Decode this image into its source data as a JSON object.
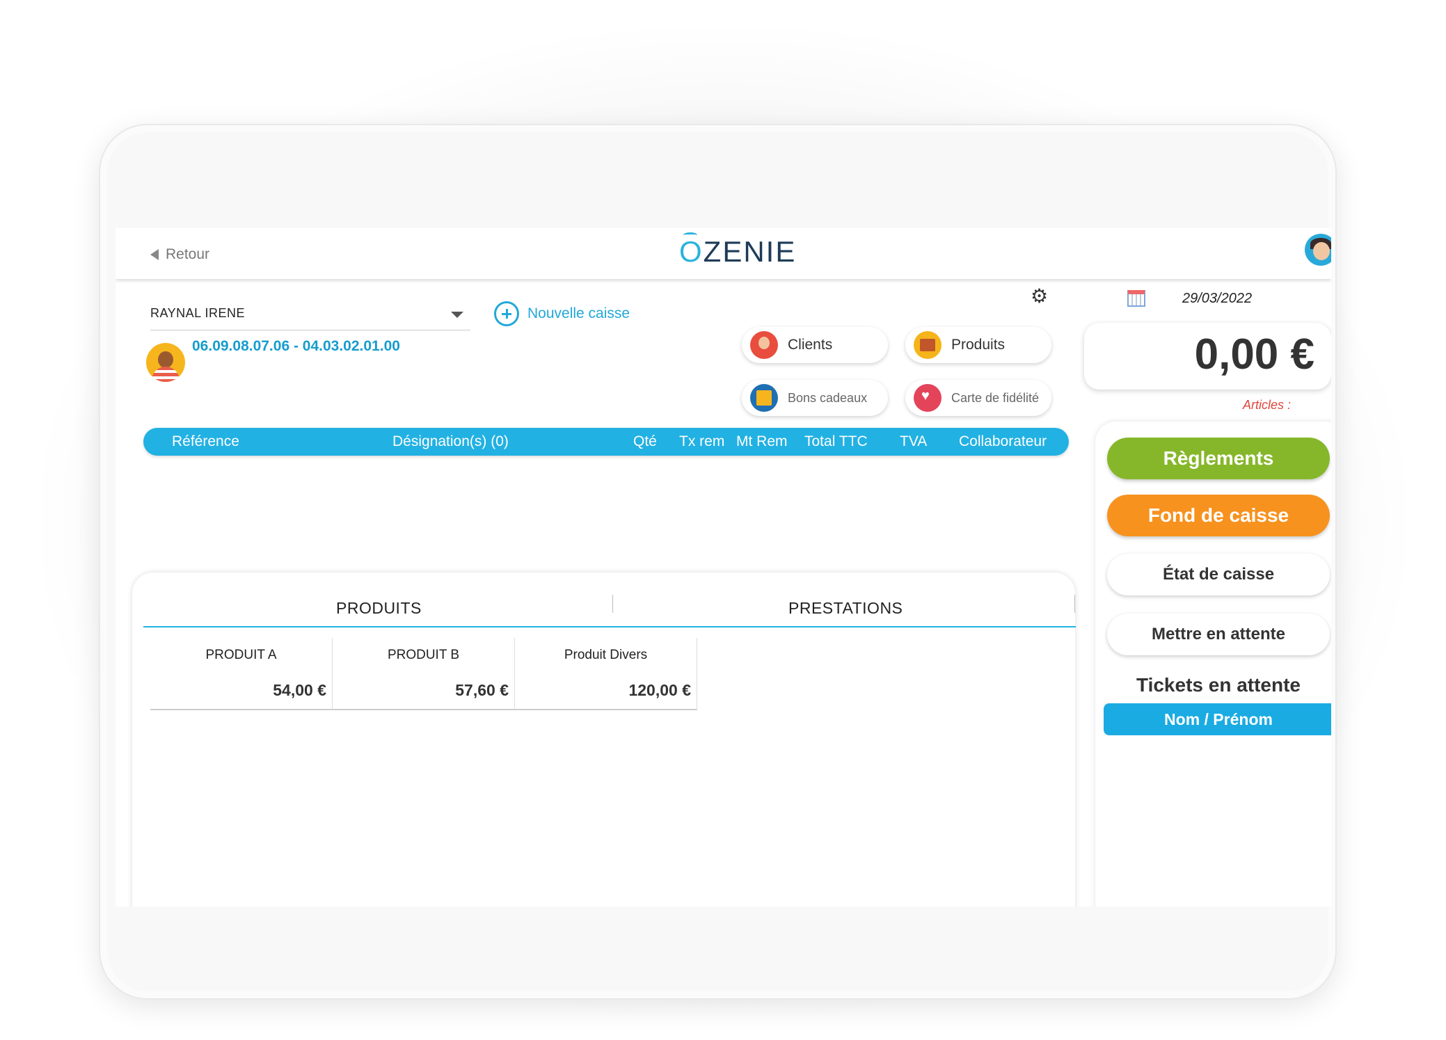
{
  "topbar": {
    "back_label": "Retour",
    "logo_text": "ZENIE",
    "logo_o": "O"
  },
  "client": {
    "name": "RAYNAL IRENE",
    "phone": "06.09.08.07.06 - 04.03.02.01.00"
  },
  "actions": {
    "nouvelle_caisse": "Nouvelle caisse",
    "clients": "Clients",
    "produits": "Produits",
    "bons_cadeaux": "Bons cadeaux",
    "carte_fidelite": "Carte de fidélité"
  },
  "table": {
    "columns": [
      "Référence",
      "Désignation(s) (0)",
      "Qté",
      "Tx rem",
      "Mt Rem",
      "Total TTC",
      "TVA",
      "Collaborateur"
    ]
  },
  "catalog": {
    "tabs": [
      "PRODUITS",
      "PRESTATIONS"
    ],
    "products": [
      {
        "name": "PRODUIT A",
        "price": "54,00 €"
      },
      {
        "name": "PRODUIT B",
        "price": "57,60 €"
      },
      {
        "name": "Produit Divers",
        "price": "120,00 €"
      }
    ]
  },
  "summary": {
    "date": "29/03/2022",
    "total": "0,00 €",
    "articles_label": "Articles :"
  },
  "side_buttons": {
    "reglements": "Règlements",
    "fond_de_caisse": "Fond de caisse",
    "etat_de_caisse": "État de caisse",
    "mettre_en_attente": "Mettre en attente"
  },
  "tickets": {
    "title": "Tickets en attente",
    "column": "Nom / Prénom"
  },
  "colors": {
    "accent": "#22b1e3",
    "green": "#86b72a",
    "orange": "#f7921e",
    "price_red": "#e0453a"
  },
  "icons": [
    "back-arrow-icon",
    "user-avatar-icon",
    "plus-circle-icon",
    "gear-icon",
    "calendar-icon",
    "clients-icon",
    "produits-icon",
    "bons-cadeaux-icon",
    "carte-fidelite-icon"
  ]
}
